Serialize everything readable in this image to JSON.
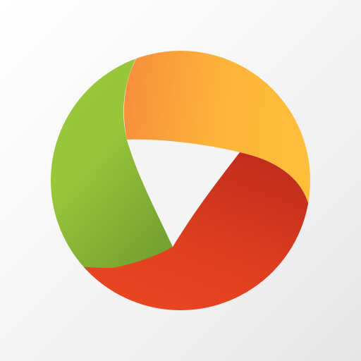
{
  "icon": {
    "name": "tricolor-ring-logo-icon",
    "colors": {
      "background_light": "#ffffff",
      "background_dark": "#e6e6e6",
      "green_light": "#9bcb3b",
      "green_dark": "#6e9a2e",
      "orange": "#f68b3c",
      "yellow": "#fec33a",
      "red_light": "#ef4a25",
      "red_dark": "#b5261c",
      "center_white": "#f4f4f4"
    }
  }
}
